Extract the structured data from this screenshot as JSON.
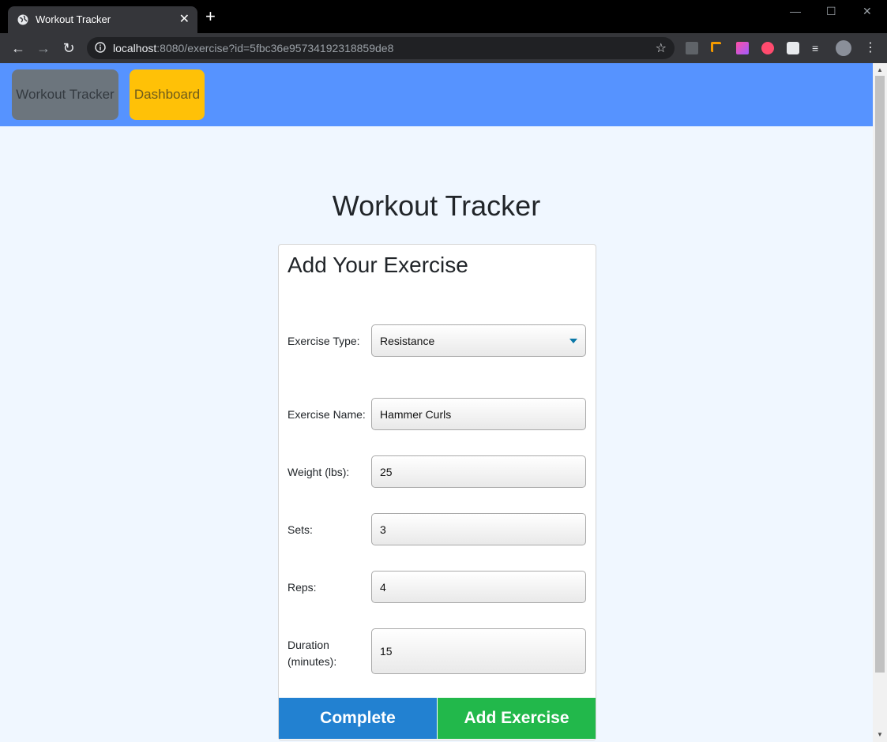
{
  "browser": {
    "tab_title": "Workout Tracker",
    "url_host": "localhost",
    "url_rest": ":8080/exercise?id=5fbc36e95734192318859de8"
  },
  "navbar": {
    "brand": "Workout Tracker",
    "dashboard": "Dashboard"
  },
  "page": {
    "heading": "Workout Tracker"
  },
  "form": {
    "title": "Add Your Exercise",
    "exercise_type": {
      "label": "Exercise Type:",
      "value": "Resistance"
    },
    "exercise_name": {
      "label": "Exercise Name:",
      "value": "Hammer Curls"
    },
    "weight": {
      "label": "Weight (lbs):",
      "value": "25"
    },
    "sets": {
      "label": "Sets:",
      "value": "3"
    },
    "reps": {
      "label": "Reps:",
      "value": "4"
    },
    "duration": {
      "label_line1": "Duration",
      "label_line2": "(minutes):",
      "value": "15"
    },
    "complete_button": "Complete",
    "add_button": "Add Exercise"
  },
  "colors": {
    "navbar": "#5693ff",
    "brand_button": "#6c757d",
    "dashboard_button": "#ffc107",
    "complete_button": "#2281d1",
    "add_button": "#22b84b",
    "page_background": "#f0f7ff"
  }
}
